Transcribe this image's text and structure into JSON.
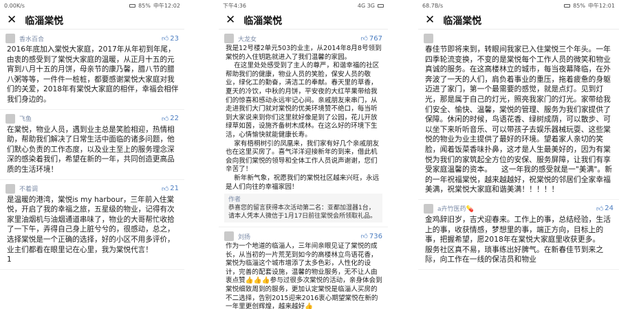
{
  "phones": [
    {
      "status": {
        "left": "0.00K/s",
        "right": "85%",
        "time": "中午12:02"
      },
      "title": "临淄棠悦",
      "comments": [
        {
          "author": "香水百合",
          "likes": "23",
          "text": "2016年底加入棠悦大家庭，2017年从年初到年尾，由衷的感受到了棠悦大家庭的温暖，从正月十五的元宵到八月十五的月饼，母亲节的康乃馨，腊八节的腊八粥等等，一件件一桩桩，都要感谢棠悦大家庭对我们的关爱，2018年有棠悦大家庭的相伴，幸福会相伴我们身边的。"
        },
        {
          "author": "飞鱼",
          "likes": "22",
          "text": "在棠悦，物业人员，遇到业主总是笑脸相迎，热情相助，帮助我们解决了日常生活中面临的诸多问题，他们默心负责的工作态度，以及业主至上的服务理念深深的感染着我们，希望在新的一年，共同创造更高品质的生活环境！"
        },
        {
          "author": "不着调",
          "likes": "21",
          "text": "是温暖的港湾，棠悦is my harbour，三年前入住棠悦，开启了我的幸福之旅，五星级的物业，记得有次家里油烟机与油烟通道串味了，物业的大哥帮忙收拾了一下午，弄得自己身上脏兮兮的，很感动，总之，选择棠悦是一个正确的选择，好的小区不用多评价，业主们都看在眼里记在心里，我为棠悦代言！\n1"
        }
      ]
    },
    {
      "status": {
        "left": "下午4:36",
        "right": "4G 3G",
        "time": ""
      },
      "title": "临淄棠悦",
      "comments": [
        {
          "author": "大龙女",
          "likes": "767",
          "text": "我是12号楼2单元503的业主，从2014年8月8号领到棠悦的入住钥匙就进入了我们温馨的家园。\n    在这里处处感受到了主人的尊严，和谐幸福的社区帮助我们的健康，物业人员的笑脸，保安人员的敬业，绿化工的勤奋，清洁工的奉献。春天里的草香，夏天的冷饮，中秋的月饼，平安夜的大红苹果带给我们的惊喜和感动永远牢记心间。亲戚朋友来串门，从走进我们大门就对棠悦的优美环境赞不绝口，每当听到大家说来到你们这里就好像是到了公园，花儿开放绿草如茵，设施齐备树木成林。在这么好的环境下生活，心情愉快就能健康长寿。\n    家有梧桐树引的凤凰来，我们家有好几个亲戚朋友也在这里买房了。喜气洋洋迎接新年的到来，借此机会向我们棠悦的领导和全体工作人员说声谢谢，您们辛苦了！\n    新年新气象，祝愿我们的棠悦社区越来兴旺，永远是人们向往的幸福家园！",
          "reply_author": "作者",
          "reply": "恭喜您的留言获得本次活动第二名：亚都加湿器1台，请本人凭本人微信于1月17日前往棠悦会所领取礼品。"
        },
        {
          "author": "刘扬",
          "likes": "736",
          "text": "作为一个地道的临淄人，三年间亲眼见证了棠悦的成长，从当初的一片荒芜到如今的高楼林立鸟语花香，棠悦为临淄这个城市增添了太多色彩，人性化的设计，完善的配套设施，温馨的物业服务，无不让人由衷点赞👍👍👍参与过很多次棠悦的活动，亲身体会到棠悦细致周到的服务，更加认定棠悦是临淄人买房的不二选择，告别2015迎来2016衷心期望棠悦在新的一年里更创辉煌，越来越好👍"
        }
      ]
    },
    {
      "status": {
        "left": "68.7B/s",
        "right": "85%",
        "time": "中午12:01"
      },
      "title": "临淄棠悦",
      "comments": [
        {
          "author": "",
          "likes": "",
          "text": "春佳节即将来到，转眼间我家已入住棠悦三个年头。一年四季轮流变换，不变的是棠悦每个工作人员的微笑和物业真诚的服务。在这高楼林立的城市，每当夜幕降临，在外奔波了一天的人们，肩负着事业的重压，拖着疲惫的身躯迈进了家门，第一个最需要的感觉，就是点灯。见到灯光，那是属于自己的灯光，照亮我家门的灯光。家带给我们安全、愉快、温馨，棠悦的管理、服务为我们家提供了保障。休闲的时候，鸟语花香、绿树成荫，可以散步、可以坐下来听听音乐、可以带孩子去娱乐器械玩耍、这些棠悦的物业为业主提供了最好的环境。望着家人亲切的笑脸，闻着饭菜香味扑鼻，这才是人生最美好的，因为有棠悦为我们的家筑起全方位的安保、服务屏障，让我们有享受家庭温馨的资本。    这一年我的感受就是一\"美满\"。新的一年祝福棠悦，越来越越好，祝棠悦的邻居们全家幸福美满，祝棠悦大家庭和谐美满！！！！！"
        },
        {
          "author": "a卉竹医药💊",
          "likes": "24",
          "text": "金鸡辞旧岁，吉犬迎春来。工作上的事，总结经验，生活上的事，收获情感，梦想里的事，端正方向，目标上的事，把握希望，愿2018年在棠悦大家庭里收获更多。\n服务社区真不易，琐事练出好脾气。在新春佳节到来之际，向工作在一线的保洁员和物业"
        }
      ]
    }
  ]
}
